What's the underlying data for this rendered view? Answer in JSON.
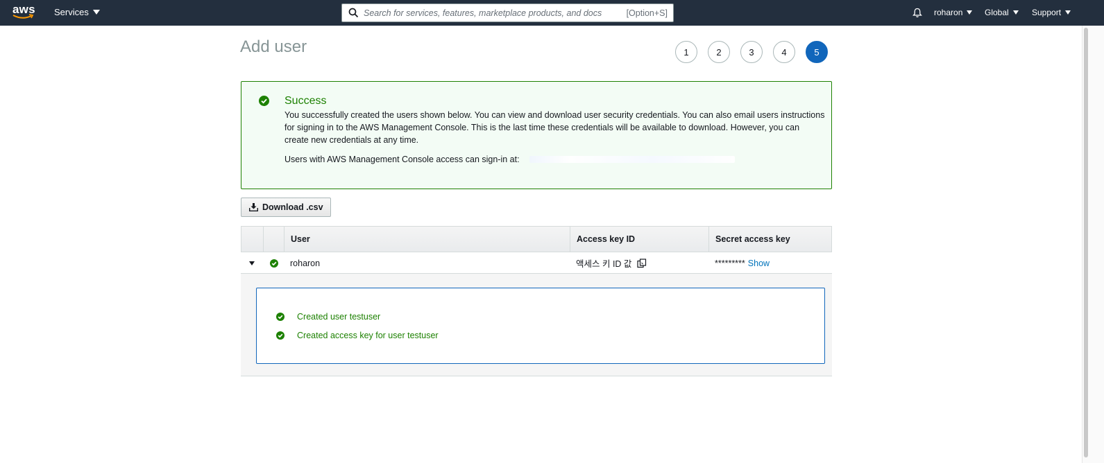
{
  "nav": {
    "logo_text": "aws",
    "services_label": "Services",
    "search_placeholder": "Search for services, features, marketplace products, and docs",
    "search_shortcut": "[Option+S]",
    "user_label": "roharon",
    "region_label": "Global",
    "support_label": "Support"
  },
  "page": {
    "title": "Add user",
    "steps": [
      "1",
      "2",
      "3",
      "4",
      "5"
    ],
    "active_step": "5"
  },
  "success": {
    "title": "Success",
    "body": "You successfully created the users shown below. You can view and download user security credentials. You can also email users instructions for signing in to the AWS Management Console. This is the last time these credentials will be available to download. However, you can create new credentials at any time.",
    "signin_label": "Users with AWS Management Console access can sign-in at:"
  },
  "download_label": "Download .csv",
  "table": {
    "headers": [
      "User",
      "Access key ID",
      "Secret access key"
    ],
    "row": {
      "user": "roharon",
      "access_key_id": "액세스 키 ID 값",
      "secret_masked": "*********",
      "show_label": "Show"
    },
    "log": [
      "Created user testuser",
      "Created access key for user testuser"
    ]
  },
  "colors": {
    "nav_bg": "#232f3e",
    "success_green": "#1d8102",
    "active_step": "#1166bb",
    "link": "#0073bb"
  }
}
